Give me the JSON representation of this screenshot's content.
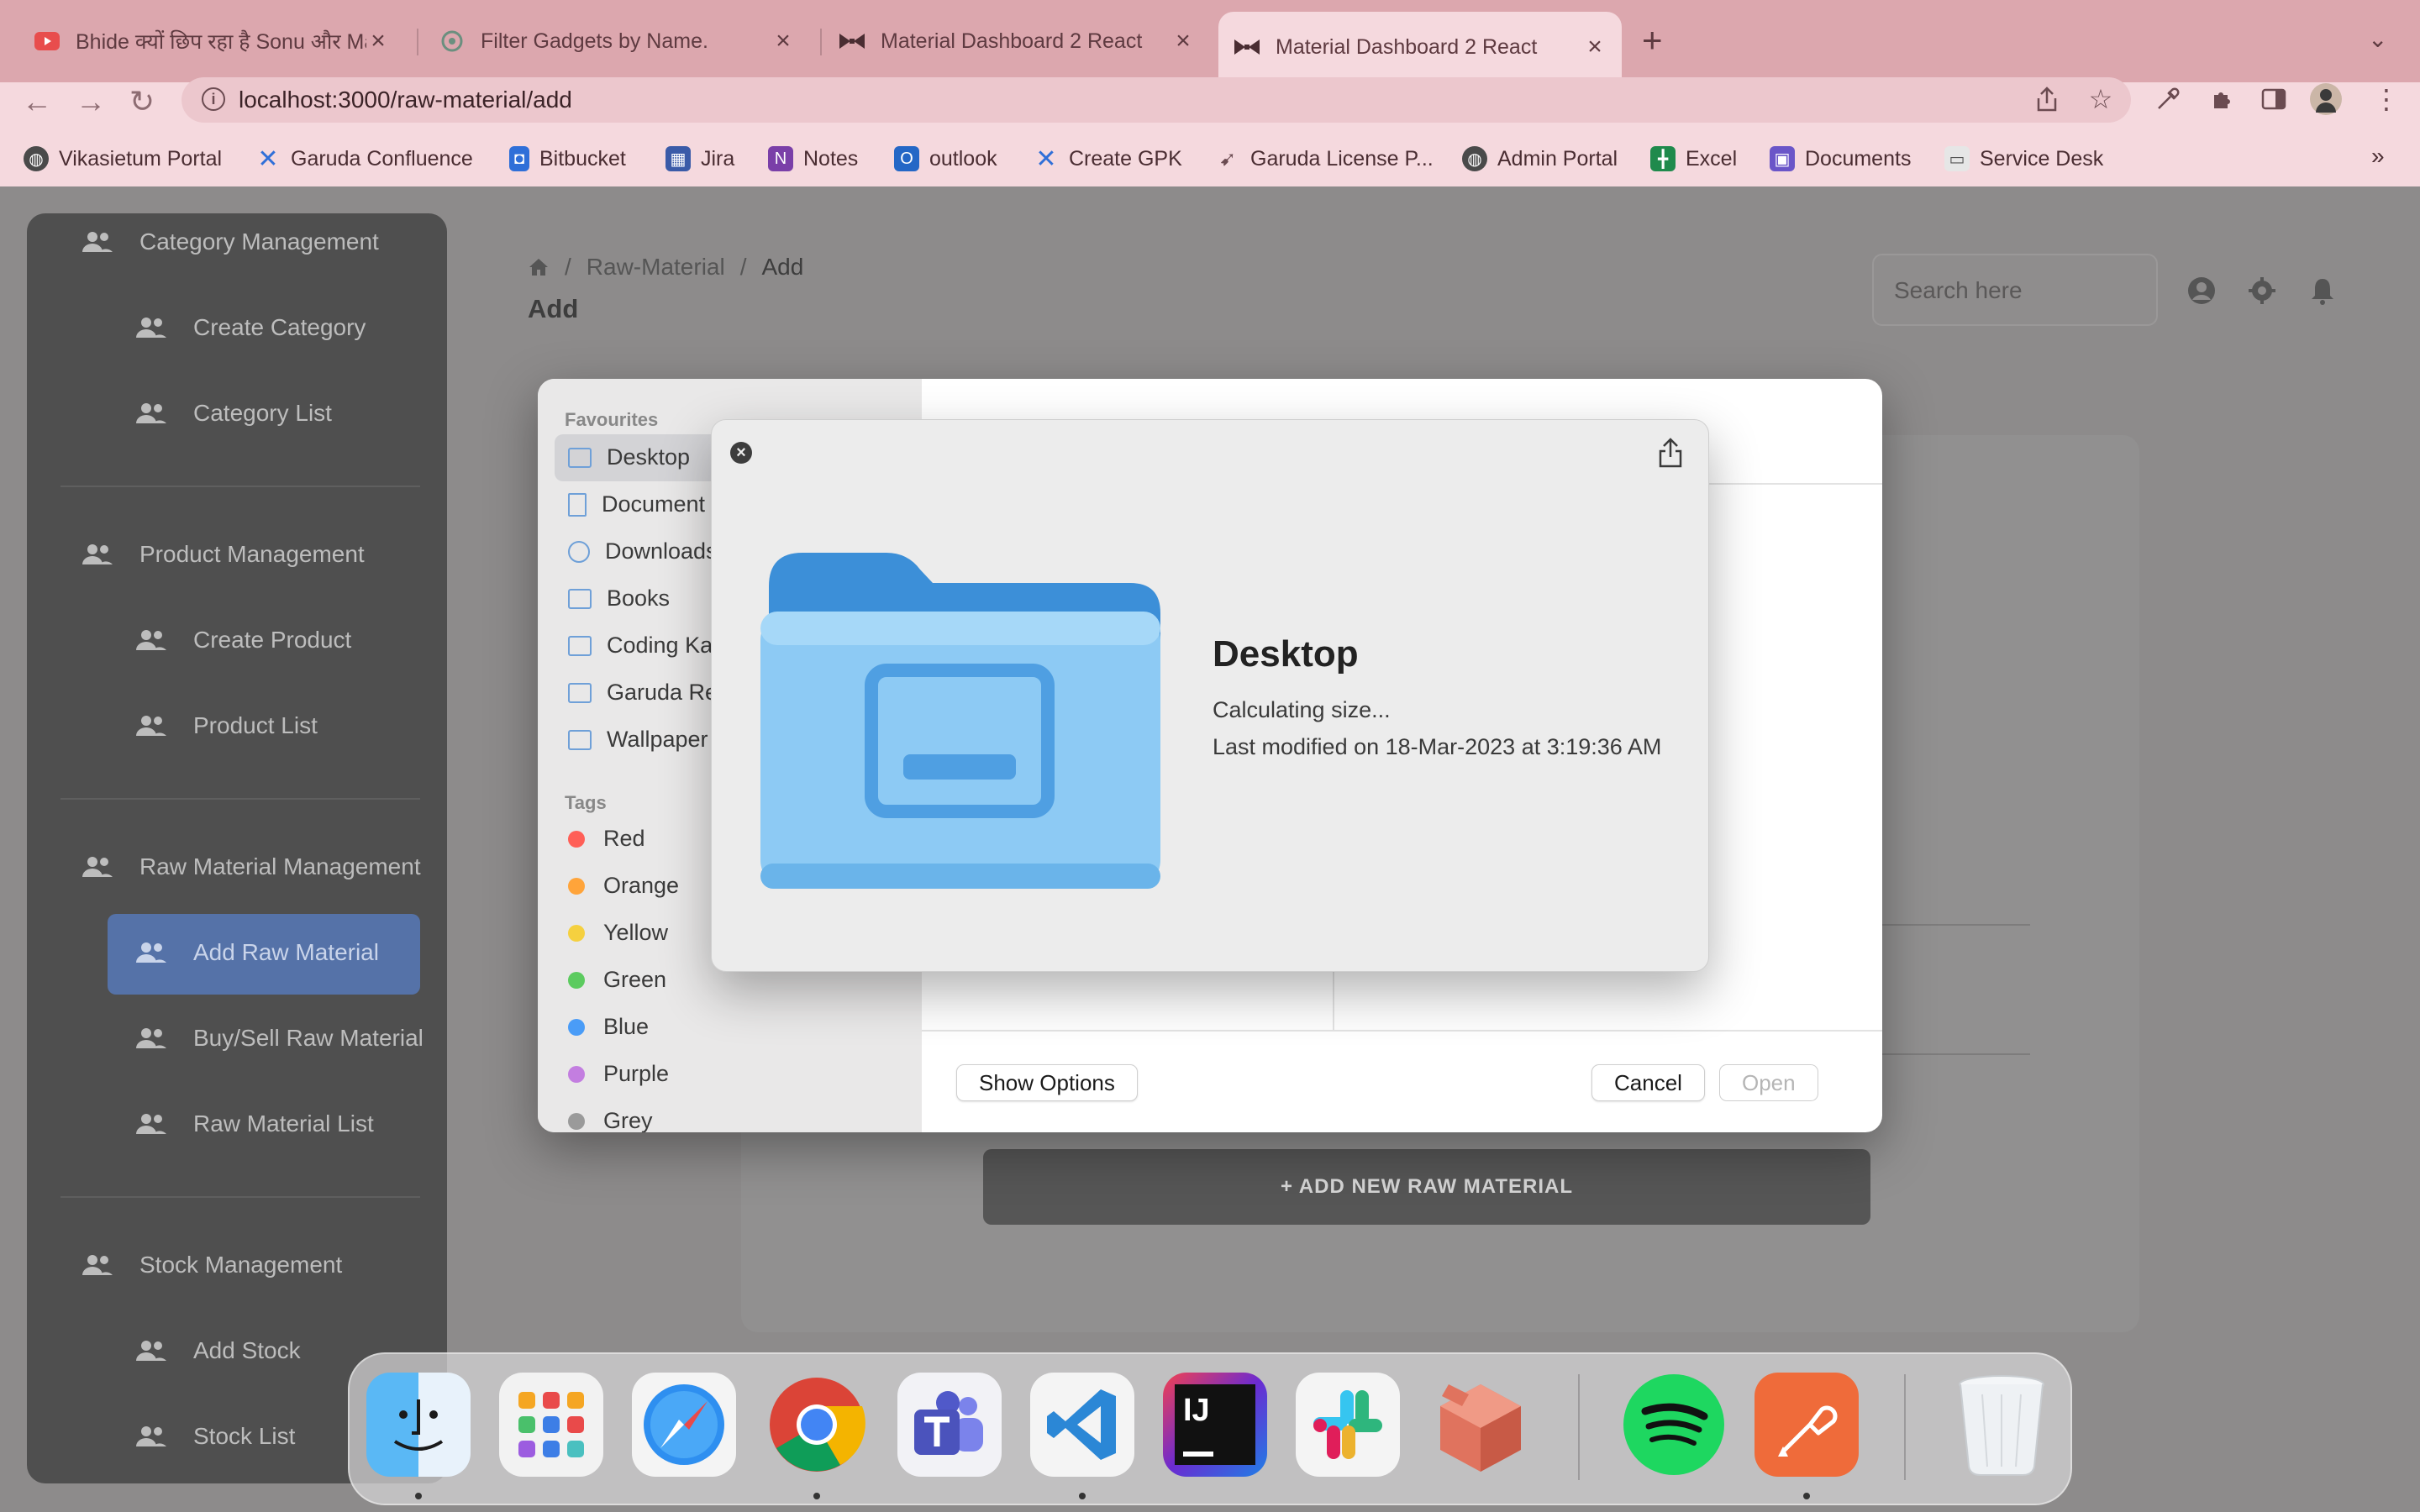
{
  "browser": {
    "tabs": [
      {
        "title": "Bhide क्यों छिप रहा है Sonu और Ma",
        "active": false
      },
      {
        "title": "Filter Gadgets by Name.",
        "active": false
      },
      {
        "title": "Material Dashboard 2 React",
        "active": false
      },
      {
        "title": "Material Dashboard 2 React",
        "active": true
      }
    ],
    "url": "localhost:3000/raw-material/add",
    "bookmarks": [
      "Vikasietum Portal",
      "Garuda Confluence",
      "Bitbucket",
      "Jira",
      "Notes",
      "outlook",
      "Create GPK",
      "Garuda License P...",
      "Admin Portal",
      "Excel",
      "Documents",
      "Service Desk"
    ],
    "tab_close_glyph": "×",
    "new_tab_glyph": "+",
    "overflow_glyph": "»"
  },
  "sidebar": {
    "items": [
      {
        "label": "Category Management",
        "level": 0
      },
      {
        "label": "Create Category",
        "level": 1
      },
      {
        "label": "Category List",
        "level": 1
      },
      {
        "label": "Product Management",
        "level": 0
      },
      {
        "label": "Create Product",
        "level": 1
      },
      {
        "label": "Product List",
        "level": 1
      },
      {
        "label": "Raw Material Management",
        "level": 0
      },
      {
        "label": "Add Raw Material",
        "level": 1,
        "active": true
      },
      {
        "label": "Buy/Sell Raw Material",
        "level": 1
      },
      {
        "label": "Raw Material List",
        "level": 1
      },
      {
        "label": "Stock Management",
        "level": 0
      },
      {
        "label": "Add Stock",
        "level": 1
      },
      {
        "label": "Stock List",
        "level": 1
      }
    ]
  },
  "header": {
    "breadcrumb": [
      "Raw-Material",
      "Add"
    ],
    "separator": "/",
    "title": "Add",
    "search_placeholder": "Search here"
  },
  "form": {
    "add_button": "+ ADD NEW RAW MATERIAL"
  },
  "file_dialog": {
    "favourites_heading": "Favourites",
    "favourites": [
      "Desktop",
      "Document",
      "Downloads",
      "Books",
      "Coding Ka",
      "Garuda Re",
      "Wallpaper"
    ],
    "tags_heading": "Tags",
    "tags": [
      {
        "name": "Red",
        "color": "#ff5f57"
      },
      {
        "name": "Orange",
        "color": "#ffa43a"
      },
      {
        "name": "Yellow",
        "color": "#f5d03f"
      },
      {
        "name": "Green",
        "color": "#5ccb5f"
      },
      {
        "name": "Blue",
        "color": "#4a9cf7"
      },
      {
        "name": "Purple",
        "color": "#c37ee0"
      },
      {
        "name": "Grey",
        "color": "#9a9a9a"
      }
    ],
    "show_options": "Show Options",
    "cancel": "Cancel",
    "open": "Open"
  },
  "quick_look": {
    "name": "Desktop",
    "size": "Calculating size...",
    "modified": "Last modified on 18-Mar-2023 at 3:19:36 AM"
  },
  "dock": {
    "apps": [
      "finder",
      "launchpad",
      "safari",
      "chrome",
      "teams",
      "vscode",
      "intellij",
      "slack",
      "bundle",
      "spotify",
      "postman",
      "trash"
    ]
  },
  "colors": {
    "tabbar": "#dca7ae",
    "toolbar": "#f5d9de",
    "sidebar_active": "#5572a8",
    "folder_blue": "#8dcaf4"
  }
}
